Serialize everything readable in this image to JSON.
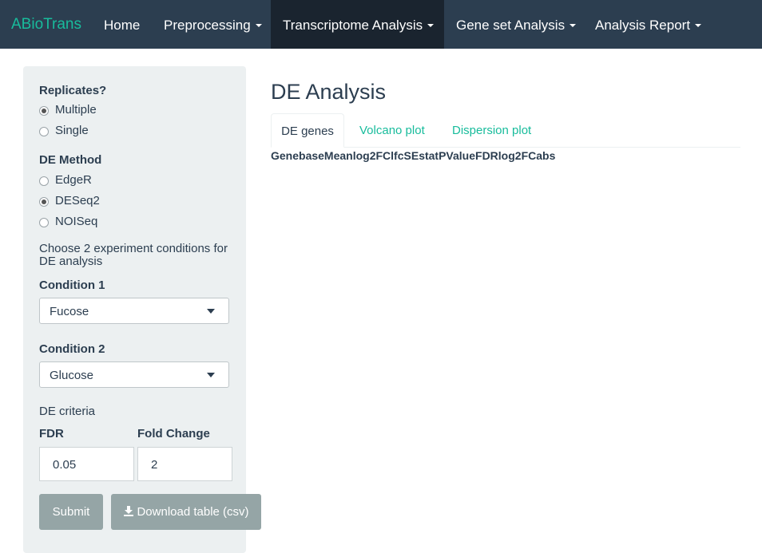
{
  "navbar": {
    "brand": "ABioTrans",
    "items": [
      {
        "label": "Home"
      },
      {
        "label": "Preprocessing"
      },
      {
        "label": "Transcriptome Analysis"
      },
      {
        "label": "Gene set Analysis"
      },
      {
        "label": "Analysis Report"
      }
    ],
    "active": "Transcriptome Analysis"
  },
  "sidebar": {
    "replicates_label": "Replicates?",
    "replicates_options": [
      "Multiple",
      "Single"
    ],
    "replicates_selected": "Multiple",
    "method_label": "DE Method",
    "method_options": [
      "EdgeR",
      "DESeq2",
      "NOISeq"
    ],
    "method_selected": "DESeq2",
    "conditions_help": "Choose 2 experiment conditions for DE analysis",
    "condition1_label": "Condition 1",
    "condition1_value": "Fucose",
    "condition2_label": "Condition 2",
    "condition2_value": "Glucose",
    "criteria_label": "DE criteria",
    "fdr_label": "FDR",
    "fdr_value": "0.05",
    "fold_label": "Fold Change",
    "fold_value": "2",
    "submit_label": "Submit",
    "download_label": "Download table (csv)"
  },
  "main": {
    "title": "DE Analysis",
    "tabs": [
      "DE genes",
      "Volcano plot",
      "Dispersion plot"
    ],
    "active_tab": "DE genes",
    "table_columns": [
      "Gene",
      "baseMean",
      "log2FC",
      "lfcSE",
      "stat",
      "PValue",
      "FDR",
      "log2FCabs"
    ]
  },
  "colors": {
    "navbar_bg": "#2c3e50",
    "navbar_active_bg": "#1a242f",
    "brand": "#18bc9c",
    "link": "#18bc9c",
    "sidebar_bg": "#ecf0f1",
    "button_bg": "#95a5a6",
    "text": "#2c3e50"
  },
  "icons": {
    "download": "download-icon",
    "caret": "caret-down-icon"
  }
}
